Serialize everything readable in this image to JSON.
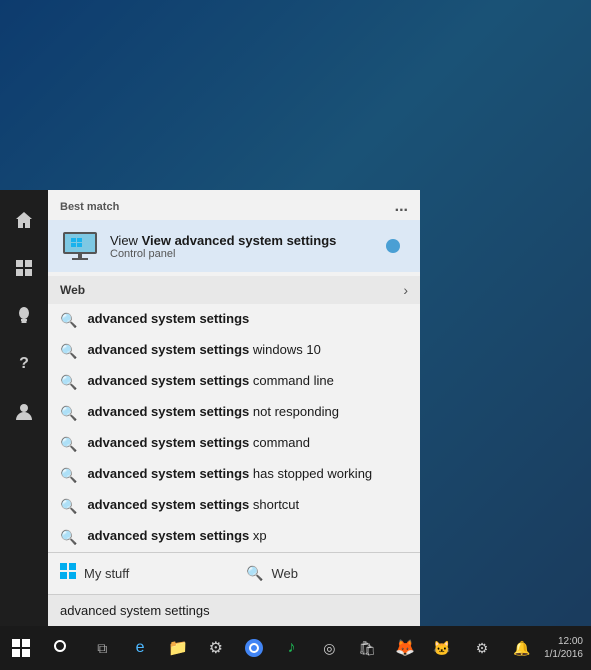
{
  "desktop": {
    "background": "#1a3a5c"
  },
  "start_menu": {
    "best_match_label": "Best match",
    "best_match_more": "...",
    "best_match_item": {
      "title_bold": "View advanced system settings",
      "subtitle": "Control panel"
    },
    "web_label": "Web",
    "results": [
      {
        "text_bold": "advanced system settings",
        "text_extra": ""
      },
      {
        "text_bold": "advanced system settings",
        "text_extra": " windows 10"
      },
      {
        "text_bold": "advanced system settings",
        "text_extra": " command line"
      },
      {
        "text_bold": "advanced system settings",
        "text_extra": " not responding"
      },
      {
        "text_bold": "advanced system settings",
        "text_extra": " command"
      },
      {
        "text_bold": "advanced system settings",
        "text_extra": " has stopped working"
      },
      {
        "text_bold": "advanced system settings",
        "text_extra": " shortcut"
      },
      {
        "text_bold": "advanced system settings",
        "text_extra": " xp"
      }
    ],
    "bottom_tabs": [
      {
        "icon": "win",
        "label": "My stuff"
      },
      {
        "icon": "search",
        "label": "Web"
      }
    ],
    "search_query": "advanced system settings"
  },
  "sidebar": {
    "icons": [
      {
        "name": "home",
        "symbol": "⌂"
      },
      {
        "name": "search",
        "symbol": "⊞"
      },
      {
        "name": "bulb",
        "symbol": "💡"
      },
      {
        "name": "question",
        "symbol": "?"
      },
      {
        "name": "person",
        "symbol": "👤"
      }
    ]
  },
  "taskbar": {
    "start_icon": "⊞",
    "search_icon": "○",
    "icons": [
      "⊞",
      "e",
      "📁",
      "⚙",
      "●",
      "♪",
      "◎",
      "🛍",
      "🦊",
      "🐱",
      "⚙"
    ],
    "right_icons": [
      "",
      "",
      "",
      ""
    ]
  }
}
